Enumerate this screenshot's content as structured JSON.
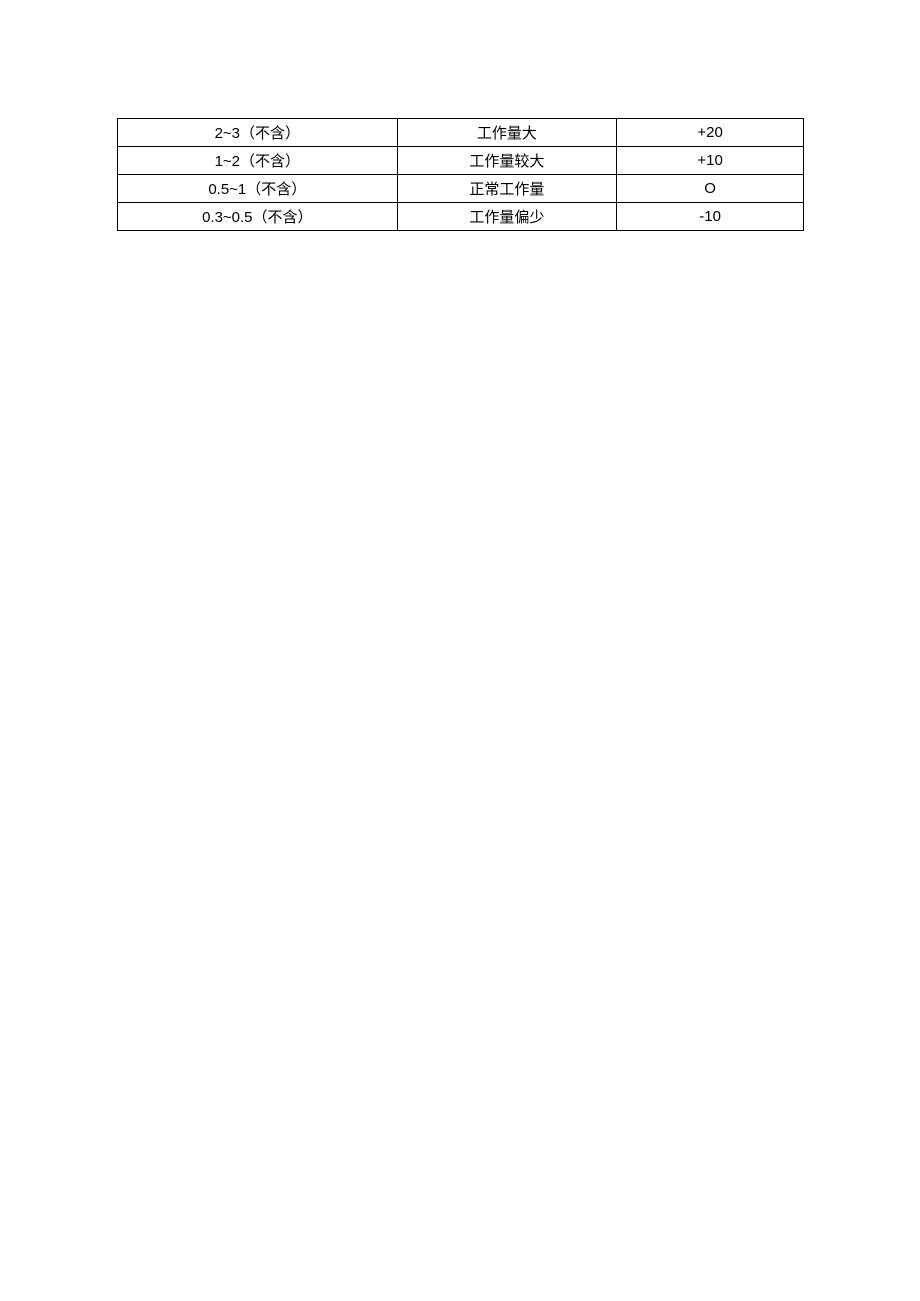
{
  "table": {
    "rows": [
      {
        "range": "2~3（不含）",
        "desc": "工作量大",
        "score": "+20"
      },
      {
        "range": "1~2（不含）",
        "desc": "工作量较大",
        "score": "+10"
      },
      {
        "range": "0.5~1（不含）",
        "desc": "正常工作量",
        "score": "O"
      },
      {
        "range": "0.3~0.5（不含）",
        "desc": "工作量偏少",
        "score": "-10"
      }
    ]
  }
}
